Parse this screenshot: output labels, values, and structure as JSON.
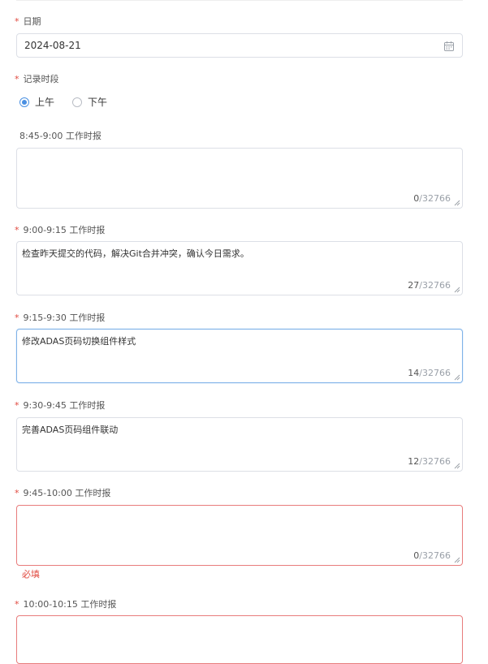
{
  "form": {
    "date": {
      "label": "日期",
      "required": true,
      "value": "2024-08-21",
      "icon": "calendar-icon"
    },
    "period": {
      "label": "记录时段",
      "required": true,
      "options": [
        {
          "label": "上午",
          "checked": true
        },
        {
          "label": "下午",
          "checked": false
        }
      ]
    },
    "reports": [
      {
        "label": "8:45-9:00 工作时报",
        "required": false,
        "value": "",
        "count": "0",
        "max": "/32766",
        "state": "normal"
      },
      {
        "label": "9:00-9:15 工作时报",
        "required": true,
        "value": "检查昨天提交的代码，解决Git合并冲突，确认今日需求。",
        "count": "27",
        "max": "/32766",
        "state": "normal"
      },
      {
        "label": "9:15-9:30 工作时报",
        "required": true,
        "value": "修改ADAS页码切换组件样式",
        "count": "14",
        "max": "/32766",
        "state": "focused"
      },
      {
        "label": "9:30-9:45 工作时报",
        "required": true,
        "value": "完善ADAS页码组件联动",
        "count": "12",
        "max": "/32766",
        "state": "normal"
      },
      {
        "label": "9:45-10:00 工作时报",
        "required": true,
        "value": "",
        "count": "0",
        "max": "/32766",
        "state": "error",
        "error": "必填"
      },
      {
        "label": "10:00-10:15 工作时报",
        "required": true,
        "value": "",
        "count": "",
        "max": "",
        "state": "error"
      }
    ]
  },
  "colors": {
    "required_star": "#e0493f",
    "focus_border": "#7fb2e8",
    "error_border": "#e87c7c",
    "radio_accent": "#4a90e2"
  }
}
